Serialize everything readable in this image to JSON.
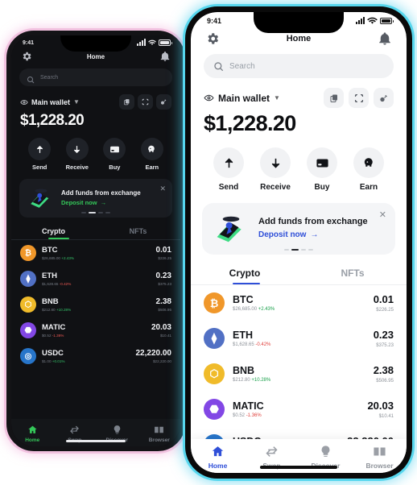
{
  "theme_colors": {
    "light_accent": "#2f4fd8",
    "dark_accent": "#34c759",
    "light_glow": "#57d7ee",
    "dark_glow": "#f2c2e0",
    "up_green": "#18a04a",
    "down_red": "#e0403c"
  },
  "status_bar": {
    "time": "9:41",
    "signal_icon": "cellular-bars-icon",
    "wifi_icon": "wifi-icon",
    "battery_icon": "battery-icon"
  },
  "header": {
    "title": "Home",
    "settings_icon": "gear-icon",
    "notification_icon": "bell-icon"
  },
  "search": {
    "placeholder": "Search",
    "icon": "search-icon"
  },
  "wallet": {
    "name": "Main wallet",
    "eye_icon": "eye-icon",
    "caret_icon": "chevron-down-icon",
    "balance": "$1,228.20",
    "actions_icons": [
      "copy-icon",
      "scan-qr-icon",
      "connect-link-icon"
    ]
  },
  "actions": [
    {
      "label": "Send",
      "icon": "arrow-up-icon"
    },
    {
      "label": "Receive",
      "icon": "arrow-down-icon"
    },
    {
      "label": "Buy",
      "icon": "credit-card-icon"
    },
    {
      "label": "Earn",
      "icon": "piggy-bank-icon"
    }
  ],
  "banner": {
    "title": "Add funds from exchange",
    "link": "Deposit now",
    "link_arrow": "arrow-right-icon",
    "close_icon": "close-icon",
    "illustration": "phone-deposit-illustration",
    "dots_count": 4,
    "active_dot": 1
  },
  "tabs": [
    {
      "label": "Crypto",
      "active": true
    },
    {
      "label": "NFTs",
      "active": false
    }
  ],
  "coins": [
    {
      "symbol": "BTC",
      "price": "$26,685.00",
      "change": "+2.43%",
      "dir": "up",
      "amount": "0.01",
      "fiat": "$226.25",
      "color": "#f0972a",
      "glyph": "₿"
    },
    {
      "symbol": "ETH",
      "price": "$1,628.65",
      "change": "-0.42%",
      "dir": "down",
      "amount": "0.23",
      "fiat": "$375.23",
      "color": "#5170c4",
      "glyph": "⧫"
    },
    {
      "symbol": "BNB",
      "price": "$212.80",
      "change": "+10.28%",
      "dir": "up",
      "amount": "2.38",
      "fiat": "$506.95",
      "color": "#f0bb2a",
      "glyph": "⬡"
    },
    {
      "symbol": "MATIC",
      "price": "$0.52",
      "change": "-1.36%",
      "dir": "down",
      "amount": "20.03",
      "fiat": "$10.41",
      "color": "#8247e5",
      "glyph": "⬣"
    },
    {
      "symbol": "USDC",
      "price": "$1.00",
      "change": "+0.01%",
      "dir": "up",
      "amount": "22,220.00",
      "fiat": "$22,220.00",
      "color": "#2775ca",
      "glyph": "◎"
    }
  ],
  "bottom_nav": [
    {
      "label": "Home",
      "icon": "home-icon",
      "active": true
    },
    {
      "label": "Swap",
      "icon": "swap-icon",
      "active": false
    },
    {
      "label": "Discover",
      "icon": "lightbulb-icon",
      "active": false
    },
    {
      "label": "Browser",
      "icon": "book-icon",
      "active": false
    }
  ]
}
